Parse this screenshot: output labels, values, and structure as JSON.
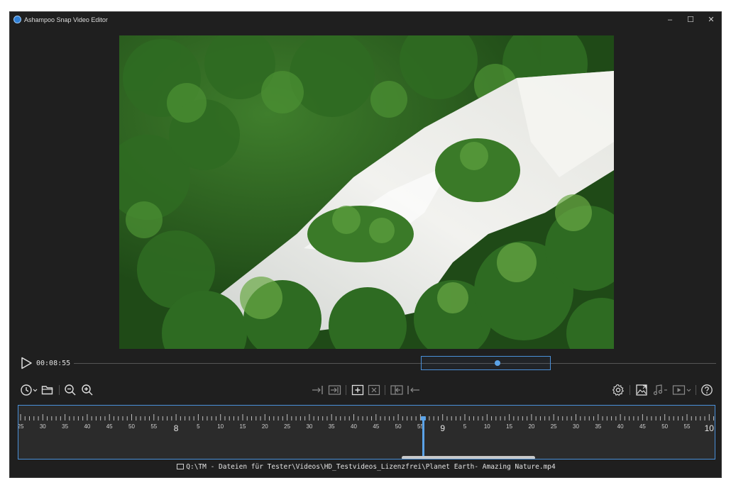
{
  "window": {
    "title": "Ashampoo Snap Video Editor",
    "minimize": "–",
    "maximize": "☐",
    "close": "✕"
  },
  "player": {
    "timecode": "00:08:55"
  },
  "toolbar": {
    "left": [
      "history-icon",
      "open-folder-icon",
      "zoom-out-icon",
      "zoom-in-icon"
    ],
    "center": [
      "cut-start-icon",
      "cut-end-icon",
      "add-marker-icon",
      "remove-marker-icon",
      "split-left-icon",
      "split-right-icon"
    ],
    "right": [
      "settings-icon",
      "export-image-icon",
      "audio-icon",
      "video-export-icon",
      "help-icon"
    ]
  },
  "timeline": {
    "minor_labels": [
      "25",
      "30",
      "35",
      "40",
      "45",
      "50",
      "55",
      "5",
      "10",
      "15",
      "20",
      "25",
      "30",
      "35",
      "40",
      "45",
      "50",
      "55",
      "5",
      "10",
      "15",
      "20",
      "25",
      "30",
      "35",
      "40",
      "45",
      "50",
      "55"
    ],
    "major_labels": [
      "8",
      "9",
      "10"
    ]
  },
  "status": {
    "file_path": "Q:\\TM - Dateien für Tester\\Videos\\HD_Testvideos_Lizenzfrei\\Planet Earth- Amazing Nature.mp4"
  },
  "colors": {
    "accent": "#4a90d9",
    "background": "#1f1f1f",
    "timeline_bg": "#2b2b2b"
  }
}
